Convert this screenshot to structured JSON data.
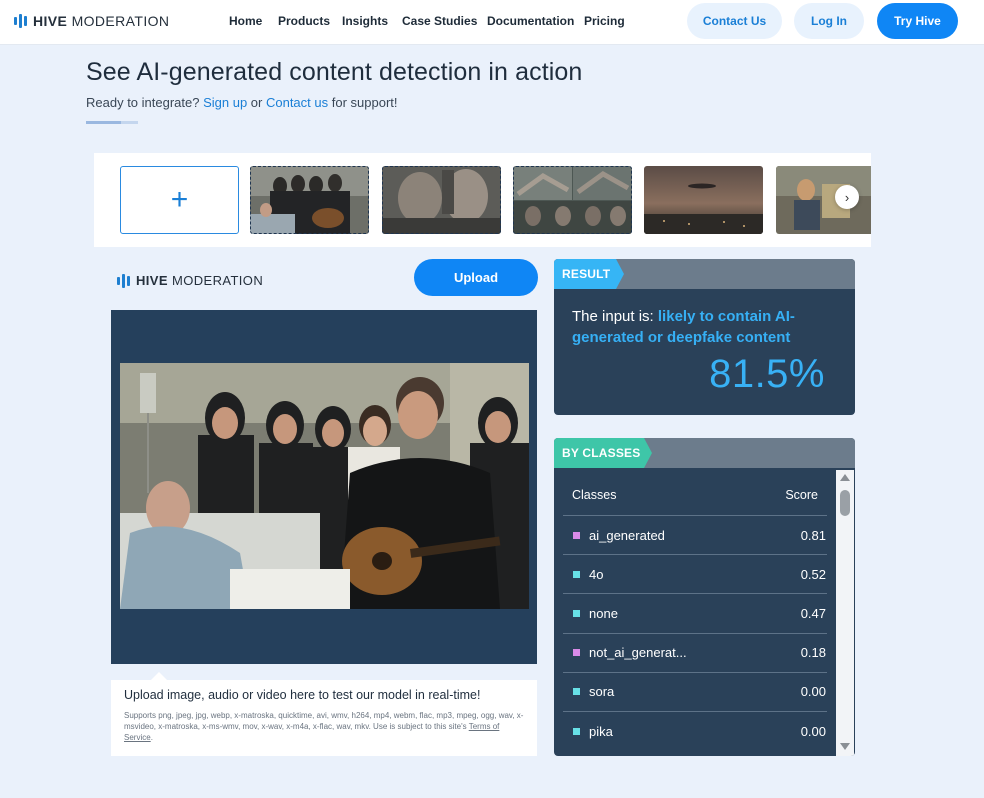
{
  "nav": {
    "brand_bold": "HIVE",
    "brand_rest": " MODERATION",
    "links": [
      "Home",
      "Products",
      "Insights",
      "Case Studies",
      "Documentation",
      "Pricing"
    ],
    "contact": "Contact Us",
    "login": "Log In",
    "try": "Try Hive"
  },
  "header": {
    "title": "See AI-generated content detection in action",
    "subtitle_prefix": "Ready to integrate? ",
    "signup": "Sign up",
    "subtitle_or": " or ",
    "contact": "Contact us",
    "subtitle_suffix": " for support!"
  },
  "thumbnails": {
    "add_icon": "+",
    "next_icon": "›",
    "items": [
      "scene-hospital-singer",
      "scene-two-men",
      "scene-collage",
      "scene-dusk-city",
      "scene-painting"
    ]
  },
  "demo": {
    "brand_bold": "HIVE",
    "brand_rest": " MODERATION",
    "upload": "Upload",
    "hint_title": "Upload image, audio or video here to test our model in real-time!",
    "hint_small": "Supports png, jpeg, jpg, webp, x-matroska, quicktime, avi, wmv, h264, mp4, webm, flac, mp3, mpeg, ogg, wav, x-msvideo, x-matroska, x-ms-wmv, mov, x-wav, x-m4a, x-flac, wav, mkv. Use is subject to this site's ",
    "terms": "Terms of Service",
    "hint_end": "."
  },
  "result": {
    "tag": "RESULT",
    "prefix": "The input is: ",
    "verdict": "likely to contain AI-generated or deepfake content",
    "percent": "81.5%"
  },
  "classes": {
    "tag": "BY CLASSES",
    "col_class": "Classes",
    "col_score": "Score",
    "rows": [
      {
        "name": "ai_generated",
        "score": "0.81",
        "color": "#d98ae8"
      },
      {
        "name": "4o",
        "score": "0.52",
        "color": "#67e0e6"
      },
      {
        "name": "none",
        "score": "0.47",
        "color": "#67e0e6"
      },
      {
        "name": "not_ai_generat...",
        "score": "0.18",
        "color": "#d98ae8"
      },
      {
        "name": "sora",
        "score": "0.00",
        "color": "#67e0e6"
      },
      {
        "name": "pika",
        "score": "0.00",
        "color": "#67e0e6"
      }
    ]
  },
  "colors": {
    "accent": "#0f86f5",
    "result_tag": "#36b5f5",
    "classes_tag": "#3ec6a8",
    "panel": "#2a4159"
  }
}
